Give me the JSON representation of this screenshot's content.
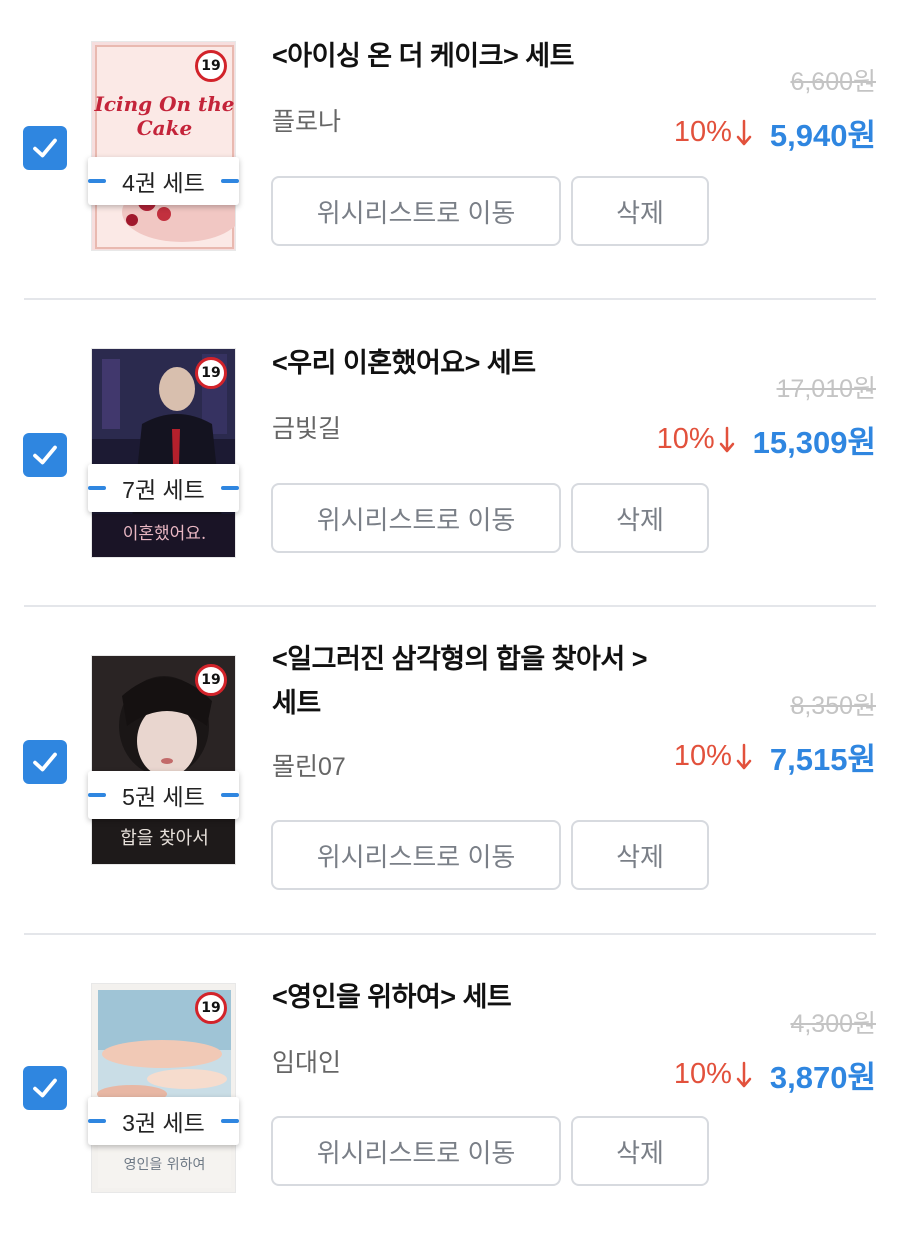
{
  "items": [
    {
      "title": "<아이싱 온 더 케이크> 세트",
      "author": "플로나",
      "set_label": "4권 세트",
      "original_price": "6,600원",
      "discount": "10%",
      "price": "5,940원",
      "age_badge": "19",
      "cover_text": "Icing On the Cake",
      "checked": true
    },
    {
      "title": "<우리 이혼했어요> 세트",
      "author": "금빛길",
      "set_label": "7권 세트",
      "original_price": "17,010원",
      "discount": "10%",
      "price": "15,309원",
      "age_badge": "19",
      "cover_text": "이혼했어요.",
      "checked": true
    },
    {
      "title": "<일그러진 삼각형의 합을 찾아서 > 세트",
      "author": "몰린07",
      "set_label": "5권 세트",
      "original_price": "8,350원",
      "discount": "10%",
      "price": "7,515원",
      "age_badge": "19",
      "cover_text": "합을 찾아서",
      "checked": true
    },
    {
      "title": "<영인을 위하여> 세트",
      "author": "임대인",
      "set_label": "3권 세트",
      "original_price": "4,300원",
      "discount": "10%",
      "price": "3,870원",
      "age_badge": "19",
      "cover_text": "영인을 위하여",
      "checked": true
    }
  ],
  "buttons": {
    "wishlist": "위시리스트로 이동",
    "delete": "삭제"
  },
  "colors": {
    "accent": "#2f86e0",
    "discount": "#e2513c",
    "age_badge_ring": "#d2232a"
  },
  "icons": {
    "checkbox": "checkmark-icon",
    "discount_arrow": "arrow-down-icon"
  }
}
